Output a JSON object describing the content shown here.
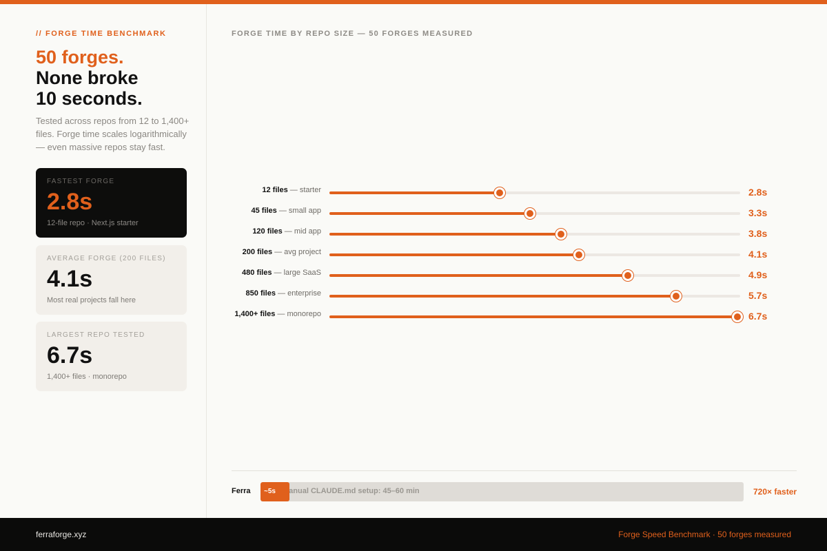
{
  "colors": {
    "accent": "#e0601c",
    "dark": "#0d0d0c",
    "card": "#f2efea",
    "track": "#ece8e3"
  },
  "sidebar": {
    "eyebrow": "// FORGE TIME BENCHMARK",
    "headline_accent": "50 forges.",
    "headline_line2": "None broke",
    "headline_line3": "10 seconds.",
    "description": "Tested across repos from 12 to 1,400+ files. Forge time scales logarithmically — even massive repos stay fast.",
    "cards": [
      {
        "label": "FASTEST FORGE",
        "value": "2.8s",
        "note": "12-file repo · Next.js starter"
      },
      {
        "label": "AVERAGE FORGE (200 FILES)",
        "value": "4.1s",
        "note": "Most real projects fall here"
      },
      {
        "label": "LARGEST REPO TESTED",
        "value": "6.7s",
        "note": "1,400+ files · monorepo"
      }
    ]
  },
  "chart_data": {
    "type": "bar",
    "title": "FORGE TIME BY REPO SIZE — 50 FORGES MEASURED",
    "orientation": "horizontal",
    "xlim": [
      0,
      6.75
    ],
    "categories": [
      {
        "size": "12 files",
        "desc": "— starter"
      },
      {
        "size": "45 files",
        "desc": "— small app"
      },
      {
        "size": "120 files",
        "desc": "— mid app"
      },
      {
        "size": "200 files",
        "desc": "— avg project"
      },
      {
        "size": "480 files",
        "desc": "— large SaaS"
      },
      {
        "size": "850 files",
        "desc": "— enterprise"
      },
      {
        "size": "1,400+ files",
        "desc": "— monorepo"
      }
    ],
    "values": [
      2.8,
      3.3,
      3.8,
      4.1,
      4.9,
      5.7,
      6.7
    ],
    "value_labels": [
      "2.8s",
      "3.3s",
      "3.8s",
      "4.1s",
      "4.9s",
      "5.7s",
      "6.7s"
    ],
    "comparison": {
      "ferra_label": "Ferra",
      "ferra_value_label": "~5s",
      "manual_label": "Manual CLAUDE.md setup: 45–60 min",
      "ferra_seconds": 5,
      "manual_seconds": 3600,
      "speedup_label": "720× faster"
    }
  },
  "footer": {
    "site": "ferraforge.xyz",
    "caption": "Forge Speed Benchmark · 50 forges measured"
  }
}
